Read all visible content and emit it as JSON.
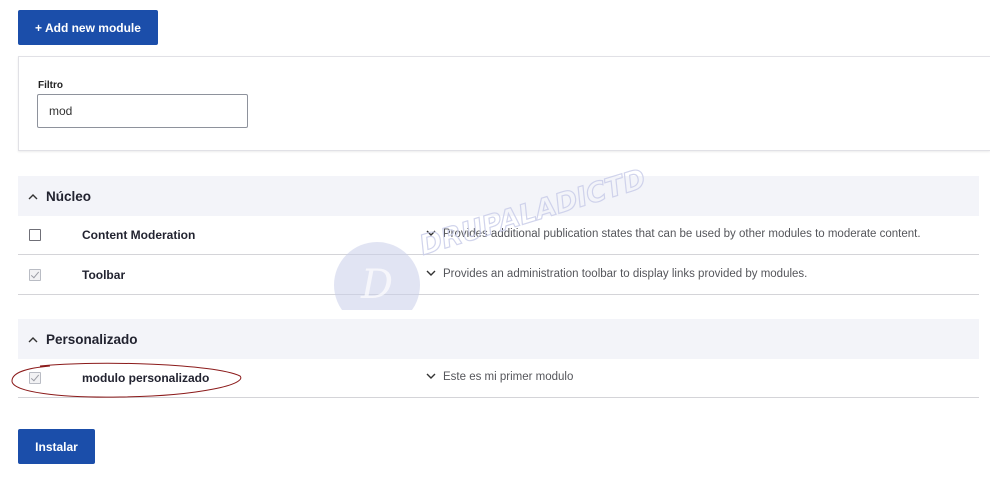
{
  "toolbar": {
    "add_module_label": "+ Add new module"
  },
  "filter": {
    "label": "Filtro",
    "value": "mod"
  },
  "groups": [
    {
      "title": "Núcleo",
      "modules": [
        {
          "name": "Content Moderation",
          "description": "Provides additional publication states that can be used by other modules to moderate content.",
          "checked": false
        },
        {
          "name": "Toolbar",
          "description": "Provides an administration toolbar to display links provided by modules.",
          "checked": true
        }
      ]
    },
    {
      "title": "Personalizado",
      "modules": [
        {
          "name": "modulo personalizado",
          "description": "Este es mi primer modulo",
          "checked": true
        }
      ]
    }
  ],
  "actions": {
    "install_label": "Instalar"
  },
  "watermark": {
    "text": "DRUPALADICTD",
    "letter": "D"
  },
  "colors": {
    "primary": "#1b4eaa",
    "group_bg": "#f3f4f9",
    "annotation": "#8b1a1a"
  }
}
